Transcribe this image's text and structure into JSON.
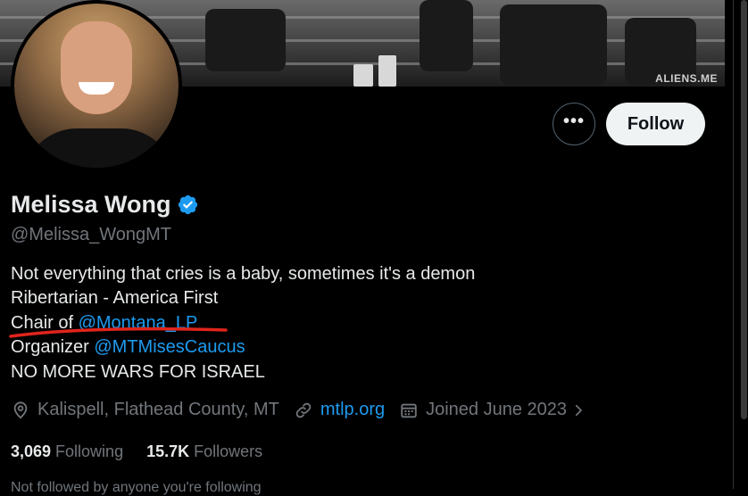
{
  "banner": {
    "watermark": "ALIENS.ME"
  },
  "profile": {
    "name": "Melissa Wong",
    "handle": "@Melissa_WongMT",
    "verified_icon": "verified-badge-icon"
  },
  "actions": {
    "more_label": "•••",
    "follow_label": "Follow"
  },
  "bio": {
    "line1": "Not everything that cries is a baby, sometimes it's a demon",
    "line2": "Ribertarian - America First",
    "line3_prefix": "Chair of ",
    "line3_link": "@Montana_LP",
    "line4_prefix": "Organizer ",
    "line4_link": "@MTMisesCaucus",
    "line5": "NO MORE WARS FOR ISRAEL"
  },
  "meta": {
    "location": "Kalispell, Flathead County, MT",
    "website": "mtlp.org",
    "joined": "Joined June 2023"
  },
  "stats": {
    "following_count": "3,069",
    "following_label": "Following",
    "followers_count": "15.7K",
    "followers_label": "Followers"
  },
  "followed_by": "Not followed by anyone you're following",
  "colors": {
    "accent": "#1d9bf0",
    "text": "#e7e9ea",
    "muted": "#71767b",
    "annotation": "#e0241b"
  }
}
